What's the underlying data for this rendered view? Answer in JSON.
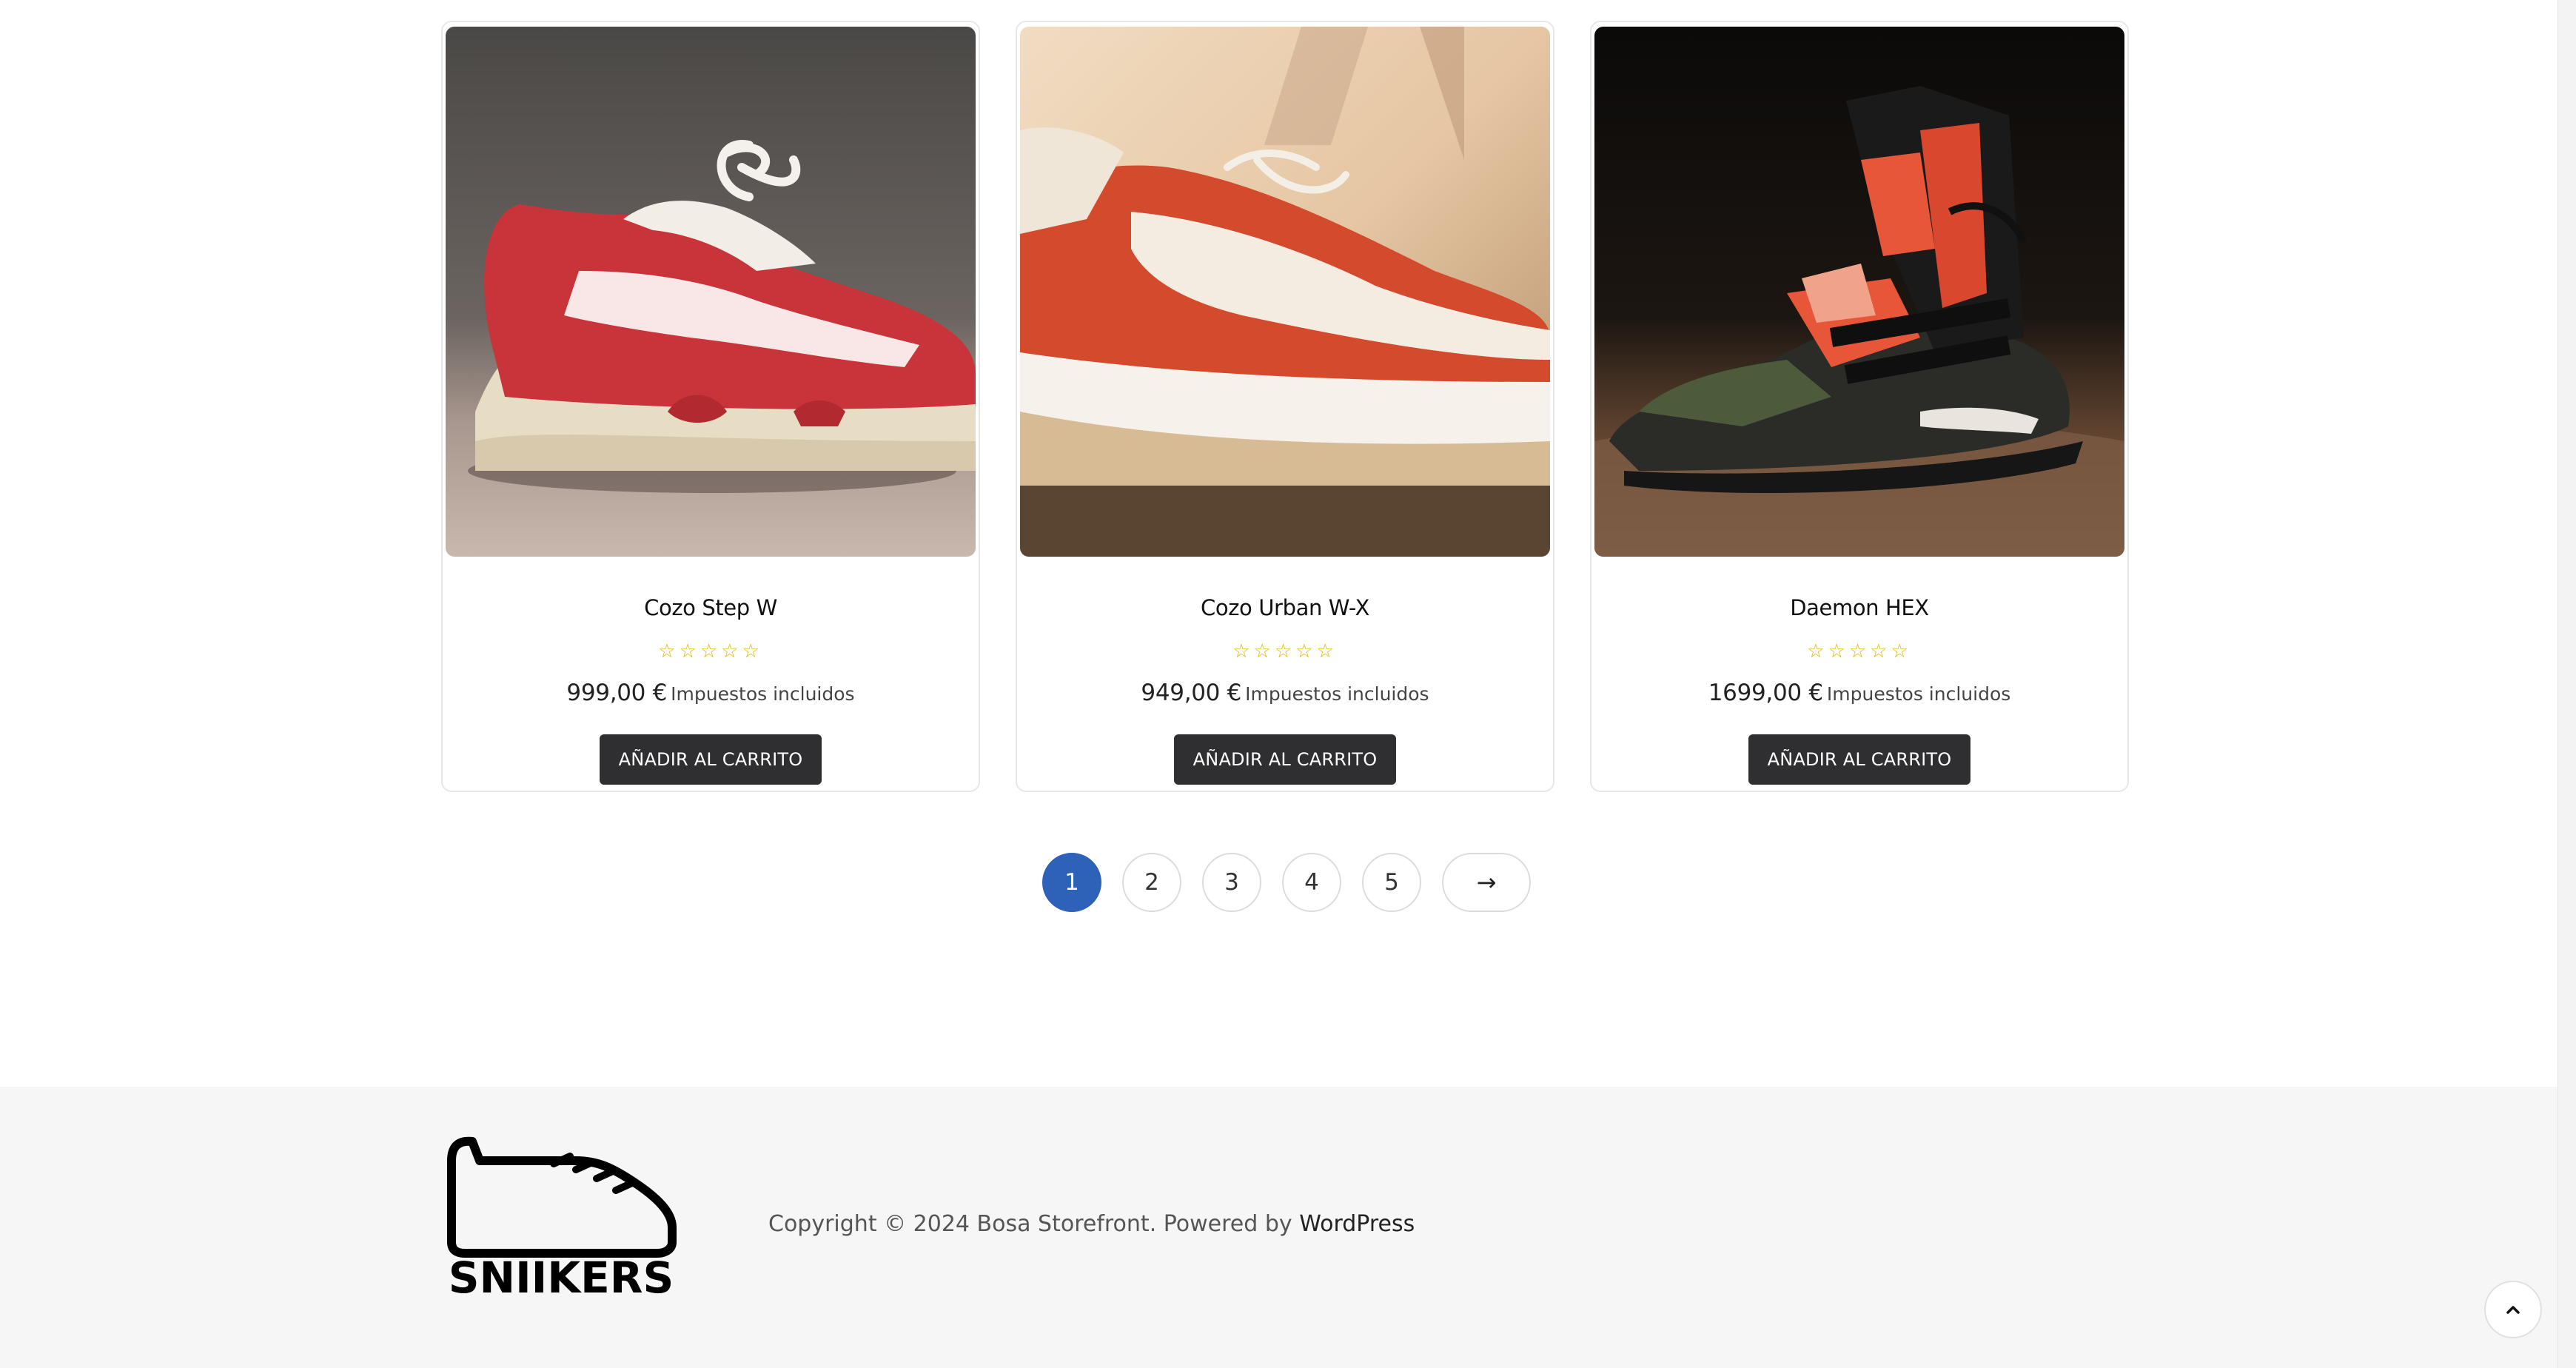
{
  "products": [
    {
      "title": "Cozo Step W",
      "rating_stars": "☆☆☆☆☆",
      "price": "999,00 €",
      "price_suffix": "Impuestos incluidos",
      "button_label": "AÑADIR AL CARRITO"
    },
    {
      "title": "Cozo Urban W-X",
      "rating_stars": "☆☆☆☆☆",
      "price": "949,00 €",
      "price_suffix": "Impuestos incluidos",
      "button_label": "AÑADIR AL CARRITO"
    },
    {
      "title": "Daemon HEX",
      "rating_stars": "☆☆☆☆☆",
      "price": "1699,00 €",
      "price_suffix": "Impuestos incluidos",
      "button_label": "AÑADIR AL CARRITO"
    }
  ],
  "pagination": {
    "pages": [
      "1",
      "2",
      "3",
      "4",
      "5"
    ],
    "current": "1",
    "next_label": "→"
  },
  "footer": {
    "logo_text": "SNIIKERS",
    "copyright_text": "Copyright © 2024 Bosa Storefront. Powered by ",
    "powered_by_link": "WordPress"
  },
  "colors": {
    "accent": "#2e62b8",
    "button_bg": "#2f2f31",
    "star": "#e0b400",
    "footer_bg": "#f6f6f6"
  },
  "icons": {
    "back_to_top": "chevron-up-icon",
    "next_page": "arrow-right-icon"
  }
}
